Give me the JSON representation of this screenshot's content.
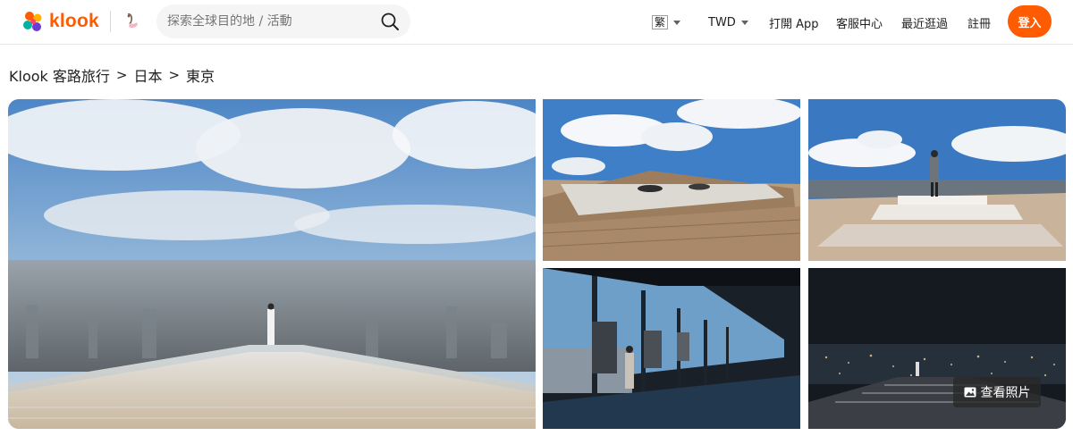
{
  "header": {
    "logo_text": "klook",
    "search": {
      "placeholder": "探索全球目的地 / 活動"
    },
    "nav": {
      "language": "繁",
      "currency": "TWD",
      "open_app": "打開 App",
      "customer_service": "客服中心",
      "recently_viewed": "最近逛過",
      "register": "註冊",
      "login": "登入"
    }
  },
  "breadcrumb": [
    "Klook 客路旅行",
    "日本",
    "東京"
  ],
  "breadcrumb_separator": ">",
  "gallery": {
    "view_photos_label": "查看照片"
  },
  "colors": {
    "brand": "#ff5b00",
    "search_bg": "#f5f5f5",
    "text": "#212121"
  },
  "icons": [
    "klook-logo-icon",
    "partner-icon",
    "search-icon",
    "caret-down-icon",
    "image-icon"
  ]
}
